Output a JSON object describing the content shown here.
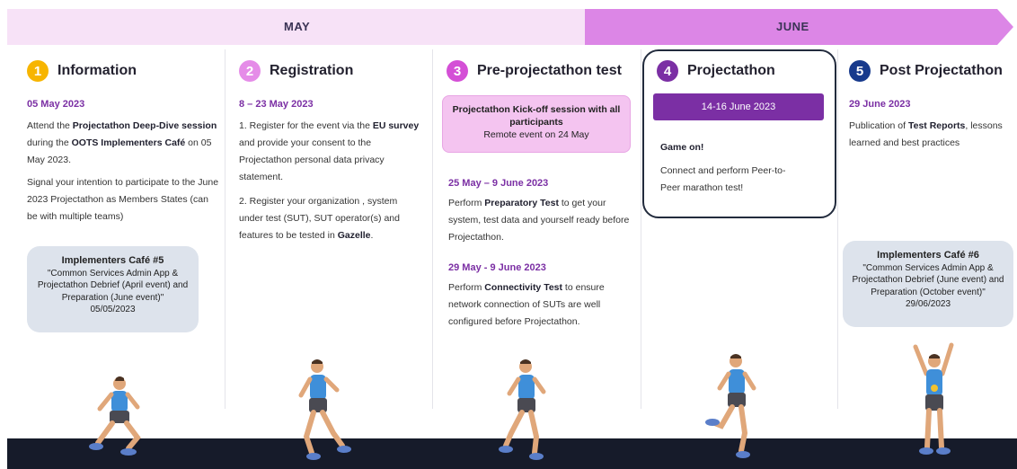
{
  "timeline": {
    "may_label": "MAY",
    "june_label": "JUNE",
    "colors": {
      "may": "#f7e2f7",
      "june": "#dc86e6"
    }
  },
  "steps": [
    {
      "number": "1",
      "title": "Information",
      "color": "#f7b500",
      "date": "05 May 2023",
      "para1": [
        "Attend the ",
        "Projectathon Deep-Dive session",
        " during the ",
        "OOTS Implementers Café",
        " on 05 May 2023."
      ],
      "para2": "Signal your intention to participate to the June 2023 Projectathon as Members States (can be with multiple teams)",
      "cafe": {
        "title": "Implementers Café #5",
        "text": "\"Common Services Admin App & Projectathon Debrief (April event) and Preparation (June event)\"",
        "date": "05/05/2023"
      }
    },
    {
      "number": "2",
      "title": "Registration",
      "color": "#e58ce8",
      "date": "8 – 23 May 2023",
      "para1": [
        "1. Register for the event via the ",
        "EU survey",
        " and provide your consent to the Projectathon personal data privacy statement."
      ],
      "para2": [
        "2. Register your organization , system under test (SUT), SUT operator(s)  and features to be tested in ",
        "Gazelle",
        "."
      ]
    },
    {
      "number": "3",
      "title": "Pre-projectathon test",
      "color": "#d44fd6",
      "kickoff": {
        "title": "Projectathon Kick-off session with all participants",
        "sub": "Remote event on 24 May"
      },
      "date1": "25 May – 9 June 2023",
      "para1": [
        "Perform ",
        "Preparatory Test",
        " to get your system, test data and yourself ready before Projectathon."
      ],
      "date2": "29 May - 9 June 2023",
      "para2": [
        "Perform ",
        "Connectivity Test",
        " to ensure network connection of SUTs are well configured before Projectathon."
      ]
    },
    {
      "number": "4",
      "title": "Projectathon",
      "color": "#7b2fa4",
      "bar": "14-16 June 2023",
      "heading": "Game on!",
      "text": "Connect and perform Peer-to-Peer marathon test!"
    },
    {
      "number": "5",
      "title": "Post Projectathon",
      "color": "#173a8c",
      "date": "29 June 2023",
      "para1": [
        "Publication of ",
        "Test Reports",
        ", lessons learned and best practices"
      ],
      "cafe": {
        "title": "Implementers Café #6",
        "text": "\"Common Services Admin App & Projectathon Debrief (June event) and Preparation (October event)\"",
        "date": "29/06/2023"
      }
    }
  ]
}
